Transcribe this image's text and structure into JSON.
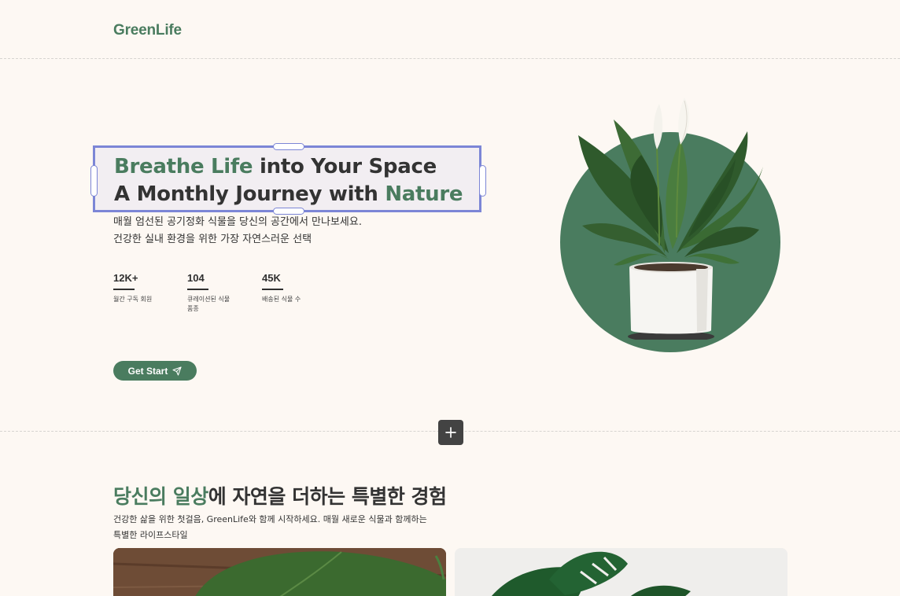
{
  "header": {
    "logo": "GreenLife"
  },
  "hero": {
    "headline_line1_accent": "Breathe Life",
    "headline_line1_rest": " into Your Space",
    "headline_line2_start": "A Monthly Journey with ",
    "headline_line2_accent": "Nature",
    "subtext_line1": "매월 엄선된 공기정화 식물을 당신의 공간에서 만나보세요.",
    "subtext_line2": "건강한 실내 환경을 위한 가장 자연스러운 선택",
    "stats": [
      {
        "value": "12K+",
        "label": "월간 구독 회원"
      },
      {
        "value": "104",
        "label": "큐레이션된 식물 품종"
      },
      {
        "value": "45K",
        "label": "배송된 식물 수"
      }
    ],
    "cta_label": "Get Start",
    "cta_icon": "send-icon"
  },
  "toolbar": {
    "add_icon": "plus-icon"
  },
  "section": {
    "title_accent": "당신의 일상",
    "title_rest": "에 자연을 더하는 특별한 경험",
    "desc_line1": "건강한 삶을 위한 첫걸음, GreenLife와 함께 시작하세요. 매월 새로운 식물과 함께하는",
    "desc_line2": "특별한 라이프스타일"
  },
  "colors": {
    "brand": "#4a7c5f",
    "background": "#fdf8f3",
    "selection": "#7c86d6"
  }
}
